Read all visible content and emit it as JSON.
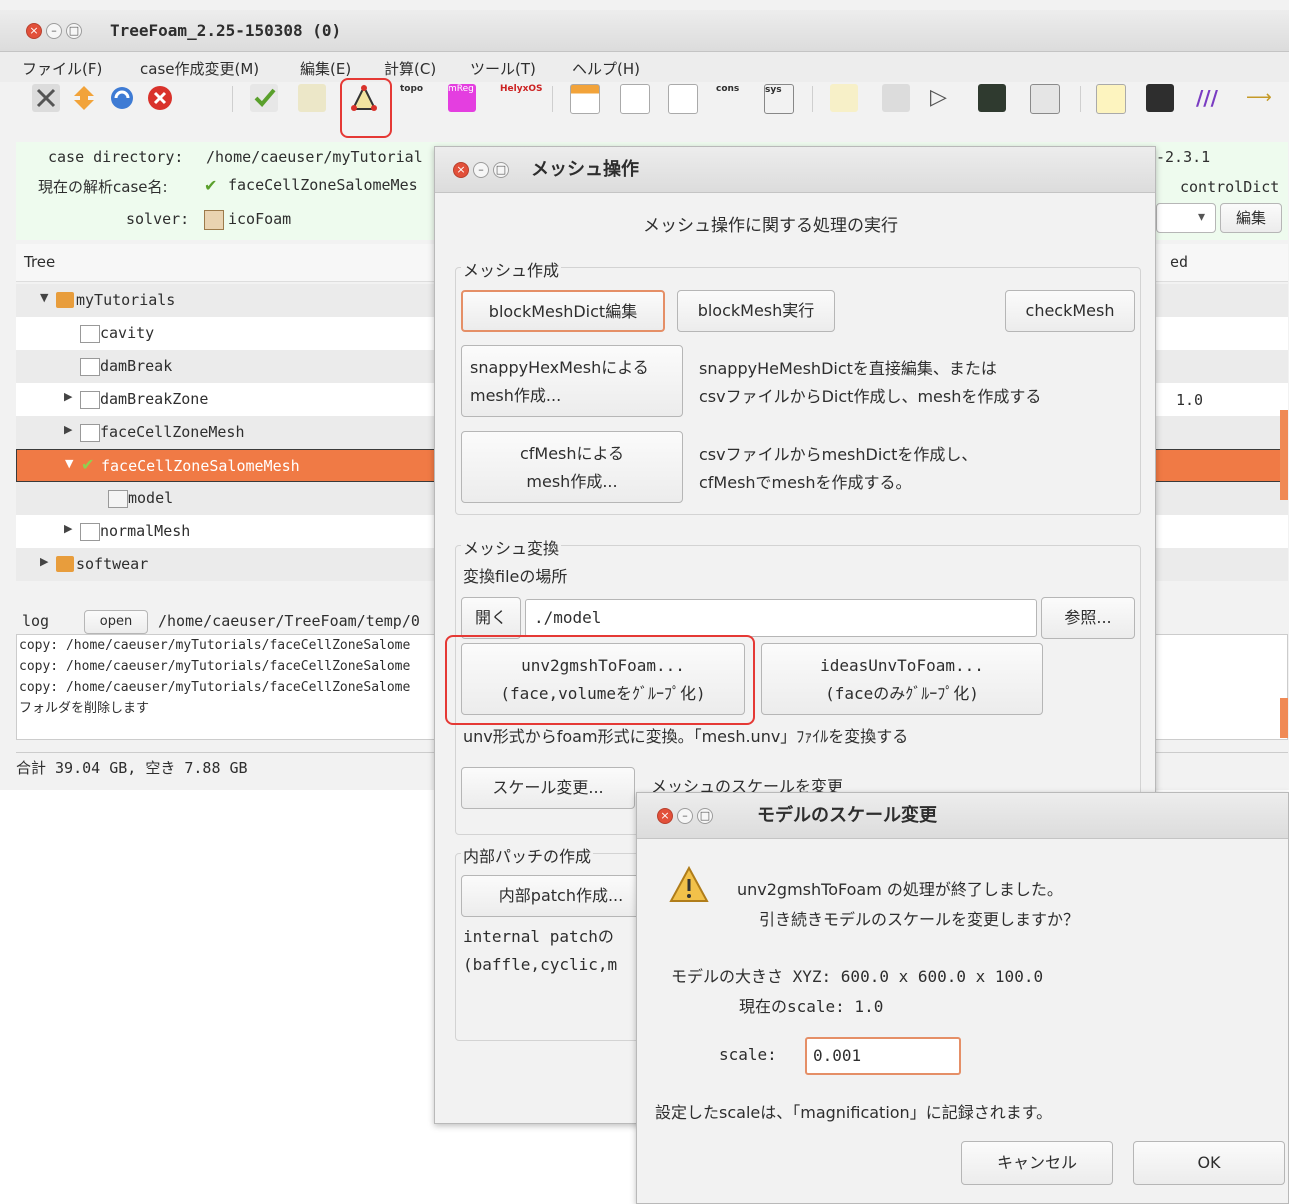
{
  "main_window": {
    "title": "TreeFoam_2.25-150308 (0)",
    "menu": [
      "ファイル(F)",
      "case作成変更(M)",
      "編集(E)",
      "計算(C)",
      "ツール(T)",
      "ヘルプ(H)"
    ],
    "toolbar_text_icons": {
      "topo": "topo",
      "mreg": "mReg",
      "helyx": "HelyxOS",
      "cons": "cons",
      "sys": "sys"
    },
    "case_directory_label": "case directory:",
    "case_directory_value": "/home/caeuser/myTutorial",
    "current_case_label": "現在の解析case名:",
    "current_case_value": "faceCellZoneSalomeMes",
    "solver_label": "solver:",
    "solver_value": "icoFoam",
    "version_text": "-2.3.1",
    "controldict_label": "controlDict",
    "edit_button": "編集",
    "dropdown_arrow": "▾",
    "tree_header": "Tree",
    "tree_header_right": "ed",
    "tree": [
      {
        "label": "myTutorials",
        "toggle": "▼",
        "icon": "folder"
      },
      {
        "label": "cavity",
        "toggle": "",
        "icon": "file"
      },
      {
        "label": "damBreak",
        "toggle": "",
        "icon": "file"
      },
      {
        "label": "damBreakZone",
        "toggle": "▶",
        "icon": "file"
      },
      {
        "label": "faceCellZoneMesh",
        "toggle": "▶",
        "icon": "file"
      },
      {
        "label": "faceCellZoneSalomeMesh",
        "toggle": "▼",
        "icon": "checked",
        "selected": true
      },
      {
        "label": "model",
        "toggle": "",
        "icon": "doc"
      },
      {
        "label": "normalMesh",
        "toggle": "▶",
        "icon": "file"
      },
      {
        "label": "softwear",
        "toggle": "▶",
        "icon": "folder"
      }
    ],
    "right_value": "1.0",
    "log_label": "log",
    "log_open_button": "open",
    "log_path": "/home/caeuser/TreeFoam/temp/0",
    "log_lines": [
      "copy: /home/caeuser/myTutorials/faceCellZoneSalome",
      "copy: /home/caeuser/myTutorials/faceCellZoneSalome",
      "copy: /home/caeuser/myTutorials/faceCellZoneSalome",
      "フォルダを削除します"
    ],
    "status": "合計 39.04 GB,  空き 7.88 GB"
  },
  "mesh_dialog": {
    "title": "メッシュ操作",
    "heading": "メッシュ操作に関する処理の実行",
    "create_section": "メッシュ作成",
    "blockmeshdict_button": "blockMeshDict編集",
    "blockmesh_run_button": "blockMesh実行",
    "checkmesh_button": "checkMesh",
    "snappy_button": [
      "snappyHexMeshによる",
      "mesh作成..."
    ],
    "snappy_desc": [
      "snappyHeMeshDictを直接編集、または",
      "csvファイルからDict作成し、meshを作成する"
    ],
    "cfmesh_button": [
      "cfMeshによる",
      "mesh作成..."
    ],
    "cfmesh_desc": [
      "csvファイルからmeshDictを作成し、",
      "cfMeshでmeshを作成する。"
    ],
    "convert_section": "メッシュ変換",
    "file_location_label": "変換fileの場所",
    "open_button": "開く",
    "path_value": "./model",
    "browse_button": "参照...",
    "unv2gmsh_button": [
      "unv2gmshToFoam...",
      "(face,volumeをｸﾞﾙｰﾌﾟ化)"
    ],
    "ideas_button": [
      "ideasUnvToFoam...",
      "(faceのみｸﾞﾙｰﾌﾟ化)"
    ],
    "convert_desc": "unv形式からfoam形式に変換。「mesh.unv」ﾌｧｲﾙを変換する",
    "scale_button": "スケール変更...",
    "scale_desc": "メッシュのスケールを変更",
    "patch_section": "内部パッチの作成",
    "patch_button": "内部patch作成...",
    "patch_desc": [
      "internal patchの",
      "(baffle,cyclic,m"
    ]
  },
  "scale_dialog": {
    "title": "モデルのスケール変更",
    "message": [
      "unv2gmshToFoam の処理が終了しました。",
      "引き続きモデルのスケールを変更しますか？"
    ],
    "model_size": "モデルの大きさ XYZ: 600.0 x 600.0 x 100.0",
    "current_scale": "現在のscale: 1.0",
    "scale_label": "scale:",
    "scale_value": "0.001",
    "note": "設定したscaleは、「magnification」に記録されます。",
    "cancel_button": "キャンセル",
    "ok_button": "OK"
  }
}
